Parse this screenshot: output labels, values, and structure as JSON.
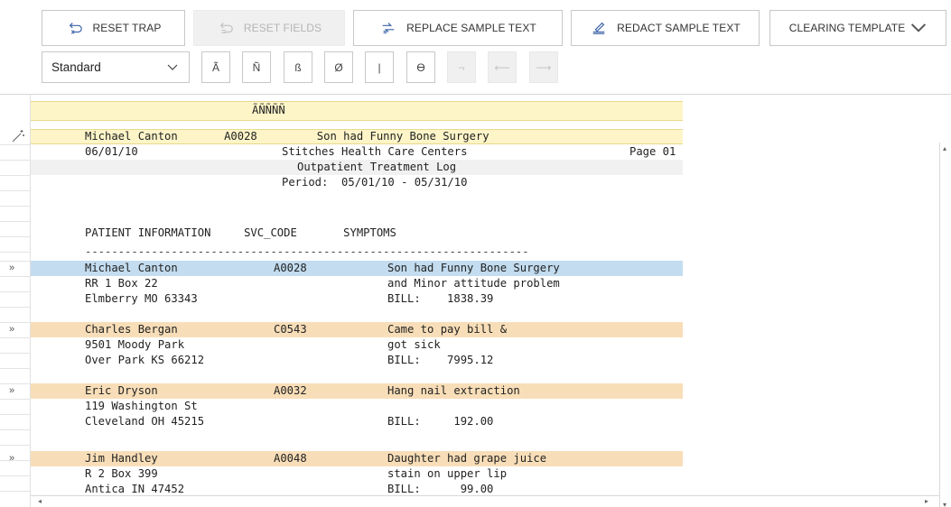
{
  "toolbar": {
    "reset_trap": "RESET TRAP",
    "reset_fields": "RESET FIELDS",
    "replace_sample": "REPLACE SAMPLE TEXT",
    "redact_sample": "REDACT SAMPLE TEXT",
    "clearing_template": "CLEARING TEMPLATE",
    "encoding": "Standard",
    "chars": [
      "Ã",
      "Ñ",
      "ß",
      "Ø",
      "|",
      "ϴ",
      "¬",
      "⟵",
      "⟶"
    ]
  },
  "trap": {
    "header_text": "ÃÑÑÑÑ",
    "sample_line": "Michael Canton       A0028         Son had Funny Bone Surgery"
  },
  "report": {
    "head_left": "06/01/10",
    "head_title": "Stitches Health Care Centers",
    "page": "Page 01",
    "subtitle": "Outpatient Treatment Log",
    "period": "Period:  05/01/10 - 05/31/10",
    "col_headers": "PATIENT INFORMATION     SVC_CODE       SYMPTOMS",
    "separator": "-------------------------------------------------------------------",
    "records": [
      {
        "name": "Michael Canton",
        "code": "A0028",
        "sym1": "Son had Funny Bone Surgery",
        "addr1": "RR 1 Box 22",
        "sym2": "and Minor attitude problem",
        "addr2": "Elmberry MO 63343",
        "bill": "BILL:    1838.39"
      },
      {
        "name": "Charles Bergan",
        "code": "C0543",
        "sym1": "Came to pay bill &",
        "addr1": "9501 Moody Park",
        "sym2": "got sick",
        "addr2": "Over Park KS 66212",
        "bill": "BILL:    7995.12"
      },
      {
        "name": "Eric Dryson",
        "code": "A0032",
        "sym1": "Hang nail extraction",
        "addr1": "119 Washington St",
        "sym2": "",
        "addr2": "Cleveland OH 45215",
        "bill": "BILL:     192.00"
      },
      {
        "name": "Jim Handley",
        "code": "A0048",
        "sym1": "Daughter had grape juice",
        "addr1": "R 2 Box 399",
        "sym2": "stain on upper lip",
        "addr2": "Antica IN 47452",
        "bill": "BILL:      99.00"
      }
    ]
  }
}
